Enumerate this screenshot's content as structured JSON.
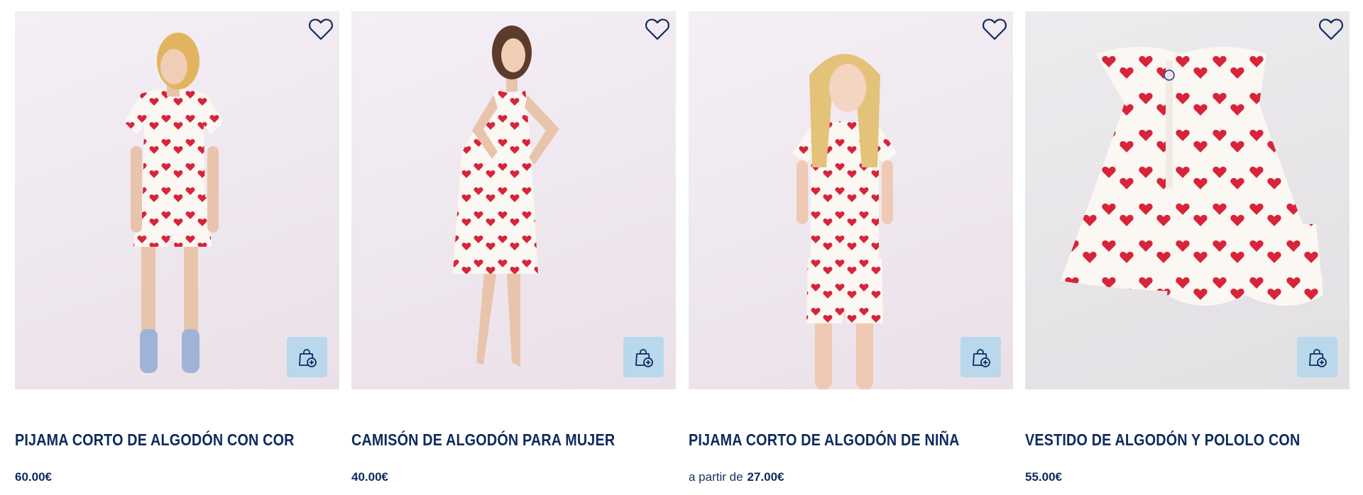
{
  "products": [
    {
      "title": "PIJAMA CORTO DE ALGODÓN CON CORAZ...",
      "price_prefix": "",
      "price": "60.00€",
      "image_bg": "pink",
      "icons": {
        "wishlist": "heart-outline-icon",
        "add_to_cart": "shopping-bag-plus-icon"
      }
    },
    {
      "title": "CAMISÓN DE ALGODÓN PARA MUJER",
      "price_prefix": "",
      "price": "40.00€",
      "image_bg": "pink",
      "icons": {
        "wishlist": "heart-outline-icon",
        "add_to_cart": "shopping-bag-plus-icon"
      }
    },
    {
      "title": "PIJAMA CORTO DE ALGODÓN DE NIÑA",
      "price_prefix": "a partir de",
      "price": "27.00€",
      "image_bg": "pink",
      "icons": {
        "wishlist": "heart-outline-icon",
        "add_to_cart": "shopping-bag-plus-icon"
      }
    },
    {
      "title": "VESTIDO DE ALGODÓN Y POLOLO CON ES...",
      "price_prefix": "",
      "price": "55.00€",
      "image_bg": "grey",
      "icons": {
        "wishlist": "heart-outline-icon",
        "add_to_cart": "shopping-bag-plus-icon"
      }
    }
  ],
  "colors": {
    "title": "#0f2a5f",
    "cart_button_bg": "#b9d8ec",
    "heart_print": "#d8243a",
    "fabric": "#fbf7f2"
  }
}
